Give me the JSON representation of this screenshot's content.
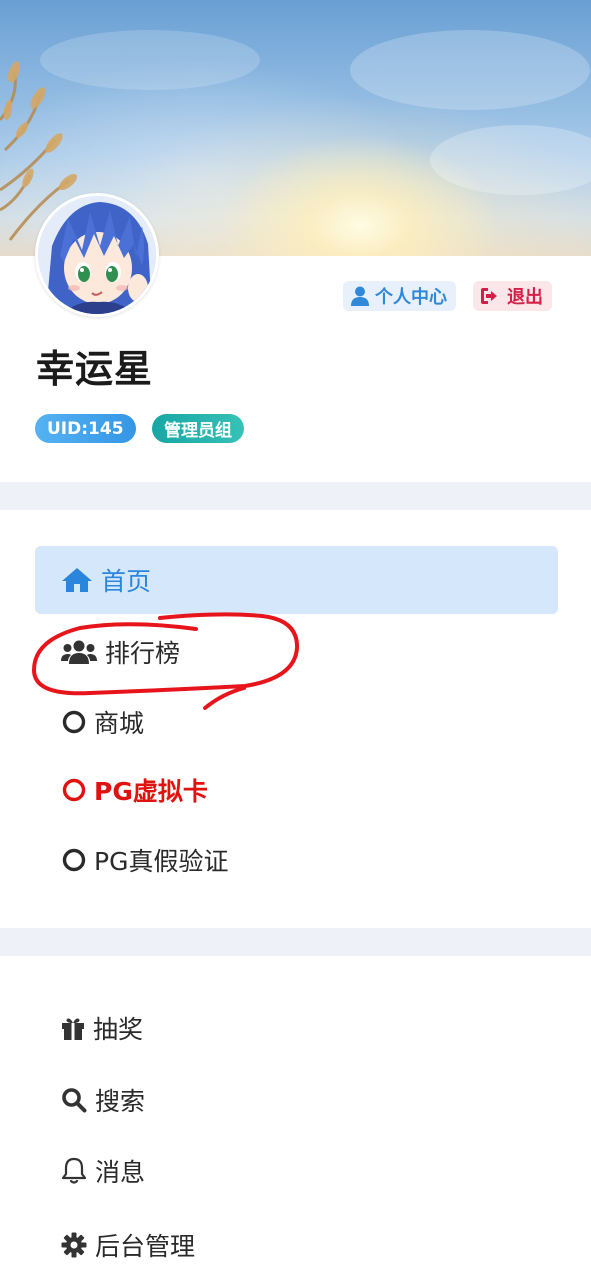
{
  "user": {
    "name": "幸运星",
    "uid_badge": "UID:145",
    "group_badge": "管理员组"
  },
  "header": {
    "profile_label": "个人中心",
    "logout_label": "退出"
  },
  "menu_primary": [
    {
      "label": "首页",
      "icon": "home-icon",
      "active": true
    },
    {
      "label": "排行榜",
      "icon": "users-icon"
    },
    {
      "label": "商城",
      "icon": "circle-outline-icon"
    },
    {
      "label": "PG虚拟卡",
      "icon": "circle-outline-icon",
      "highlight": true
    },
    {
      "label": "PG真假验证",
      "icon": "circle-outline-icon"
    }
  ],
  "menu_secondary": [
    {
      "label": "抽奖",
      "icon": "gift-icon"
    },
    {
      "label": "搜索",
      "icon": "search-icon"
    },
    {
      "label": "消息",
      "icon": "bell-icon"
    },
    {
      "label": "后台管理",
      "icon": "gear-icon"
    }
  ],
  "colors": {
    "accent_blue": "#2a86dc",
    "active_bg": "#d5e7fb",
    "logout_red": "#d51f48",
    "highlight_red": "#e0120f",
    "divider": "#eef2f8"
  }
}
